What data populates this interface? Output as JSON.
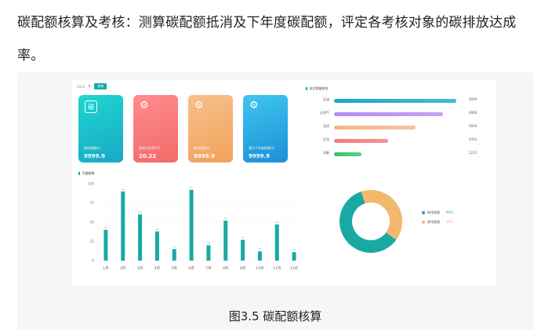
{
  "paragraph": "碳配额核算及考核：测算碳配额抵消及下年度碳配额，评定各考核对象的碳排放达成率。",
  "caption": "图3.5 碳配额核算",
  "dashboard": {
    "year_label": "2022",
    "filter_label": "年",
    "query_button": "查询",
    "cards": [
      {
        "icon": "碳",
        "label": "碳排放额(t)",
        "value": "9999.9",
        "color_from": "#1ed6d0",
        "color_to": "#19a9c4"
      },
      {
        "icon": "⚙",
        "label": "碳排达标率(%)",
        "value": "20.22",
        "color_from": "#ff8c8c",
        "color_to": "#f26a6a"
      },
      {
        "icon": "⚙",
        "label": "碳排放量(t)",
        "value": "9999.9",
        "color_from": "#f7c08a",
        "color_to": "#f2a15c"
      },
      {
        "icon": "⚙",
        "label": "预计下年度配额(t)",
        "value": "9999.9",
        "color_from": "#3fc6ef",
        "color_to": "#1b8fd8"
      }
    ],
    "bar_section_title": "本月排放排名",
    "monthly_title": "月度碳排",
    "rank_bars": [
      {
        "name": "石油",
        "value": 9999,
        "display": "9999",
        "color": "#1aa7c9"
      },
      {
        "name": "天然气",
        "value": 8888,
        "display": "8888",
        "color": "#b48cf0"
      },
      {
        "name": "光伏",
        "value": 6666,
        "display": "6666",
        "color": "#f6b38a"
      },
      {
        "name": "生化",
        "value": 4444,
        "display": "4444",
        "color": "#f27a7a"
      },
      {
        "name": "风能",
        "value": 2222,
        "display": "2222",
        "color": "#35c36b"
      }
    ],
    "donut": {
      "legend": [
        {
          "name": "碳排放量",
          "pct": "60%",
          "value": 60,
          "color": "#19a9a4"
        },
        {
          "name": "碳排放量",
          "pct": "40%",
          "value": 40,
          "color": "#f2b86b"
        }
      ]
    }
  },
  "chart_data": {
    "type": "bar",
    "title": "月度碳排",
    "categories": [
      "1月",
      "2月",
      "3月",
      "4月",
      "5月",
      "6月",
      "7月",
      "8月",
      "9月",
      "10月",
      "11月",
      "12月"
    ],
    "values": [
      40,
      90,
      60,
      38,
      15,
      92,
      20,
      52,
      27,
      12,
      47,
      11
    ],
    "ylim": [
      0,
      100
    ],
    "yticks": [
      0,
      25,
      50,
      75,
      100
    ],
    "color": "#19a9a4",
    "grid": true
  }
}
